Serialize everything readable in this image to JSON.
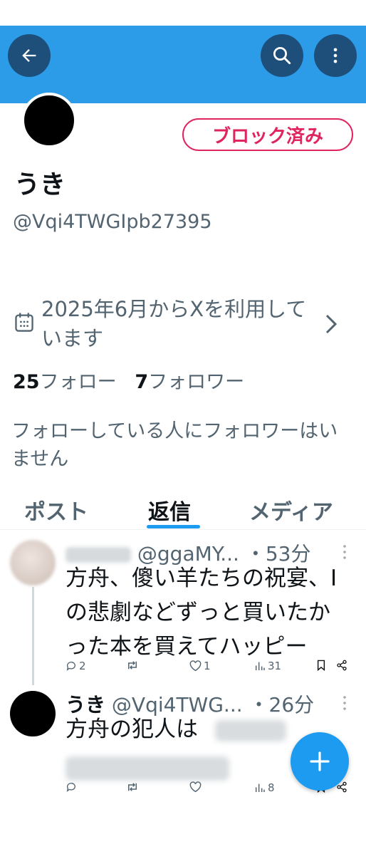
{
  "header": {
    "back_icon": "arrow-left-icon",
    "search_icon": "search-icon",
    "more_icon": "more-vertical-icon",
    "banner_color": "#2c9be8"
  },
  "profile": {
    "blocked_label": "ブロック済み",
    "name": "うき",
    "handle": "@Vqi4TWGIpb27395",
    "joined": "2025年6月からXを利用しています",
    "following_count": "25",
    "following_label": "フォロー",
    "followers_count": "7",
    "followers_label": "フォロワー",
    "no_mutual_followers": "フォローしている人にフォロワーはいません"
  },
  "tabs": [
    {
      "label": "ポスト",
      "active": false
    },
    {
      "label": "返信",
      "active": true
    },
    {
      "label": "メディア",
      "active": false
    }
  ],
  "posts": [
    {
      "handle": "@ggaMY...",
      "time": "・53分",
      "text": "方舟、傻い羊たちの祝宴、Iの悲劇などずっと買いたかった本を買えてハッピー",
      "replies": "2",
      "likes": "1",
      "views": "31"
    },
    {
      "name": "うき",
      "handle": "@Vqi4TWG...",
      "time": "・26分",
      "text_visible": "方舟の犯人は",
      "views": "8"
    }
  ],
  "fab": {
    "icon": "plus-icon"
  },
  "colors": {
    "accent": "#1d9bf0",
    "blocked": "#e0245e",
    "secondary_text": "#536471"
  }
}
